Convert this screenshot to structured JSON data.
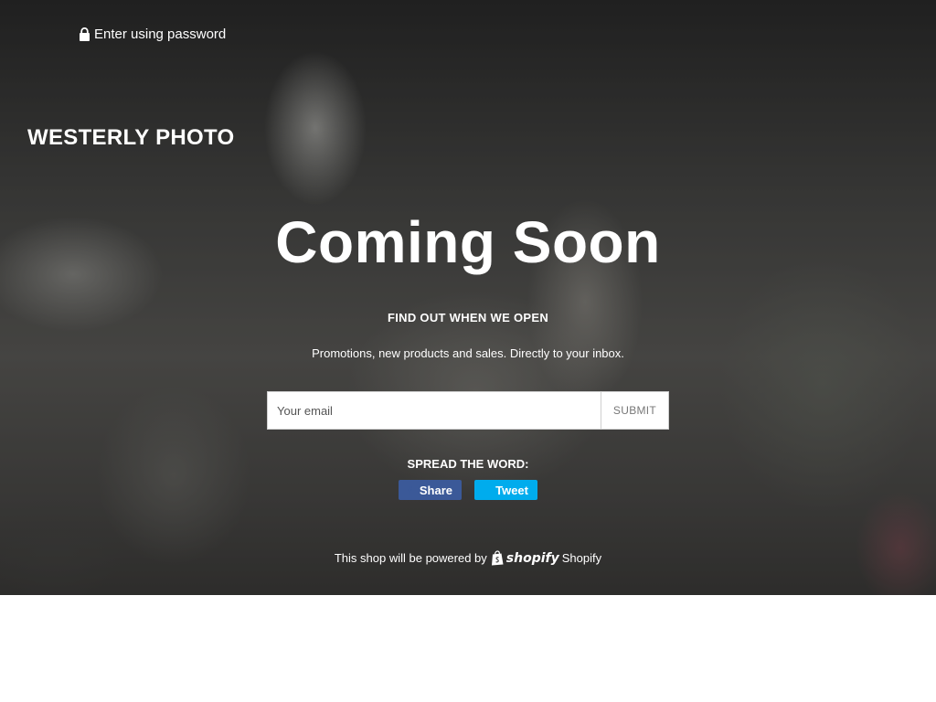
{
  "header": {
    "password_link": "Enter using password",
    "lock_icon": "lock-icon",
    "brand": "WESTERLY PHOTO"
  },
  "main": {
    "headline": "Coming Soon",
    "signup_heading": "FIND OUT WHEN WE OPEN",
    "signup_text": "Promotions, new products and sales. Directly to your inbox.",
    "email_placeholder": "Your email",
    "submit_label": "Submit"
  },
  "share": {
    "heading": "SPREAD THE WORD:",
    "facebook_label": "Share",
    "twitter_label": "Tweet",
    "facebook_color": "#3b5998",
    "twitter_color": "#00aced"
  },
  "footer": {
    "powered_text": "This shop will be powered by",
    "shopify_wordmark": "shopify",
    "shopify_link": "Shopify",
    "shopify_icon": "shopify-bag-icon"
  }
}
